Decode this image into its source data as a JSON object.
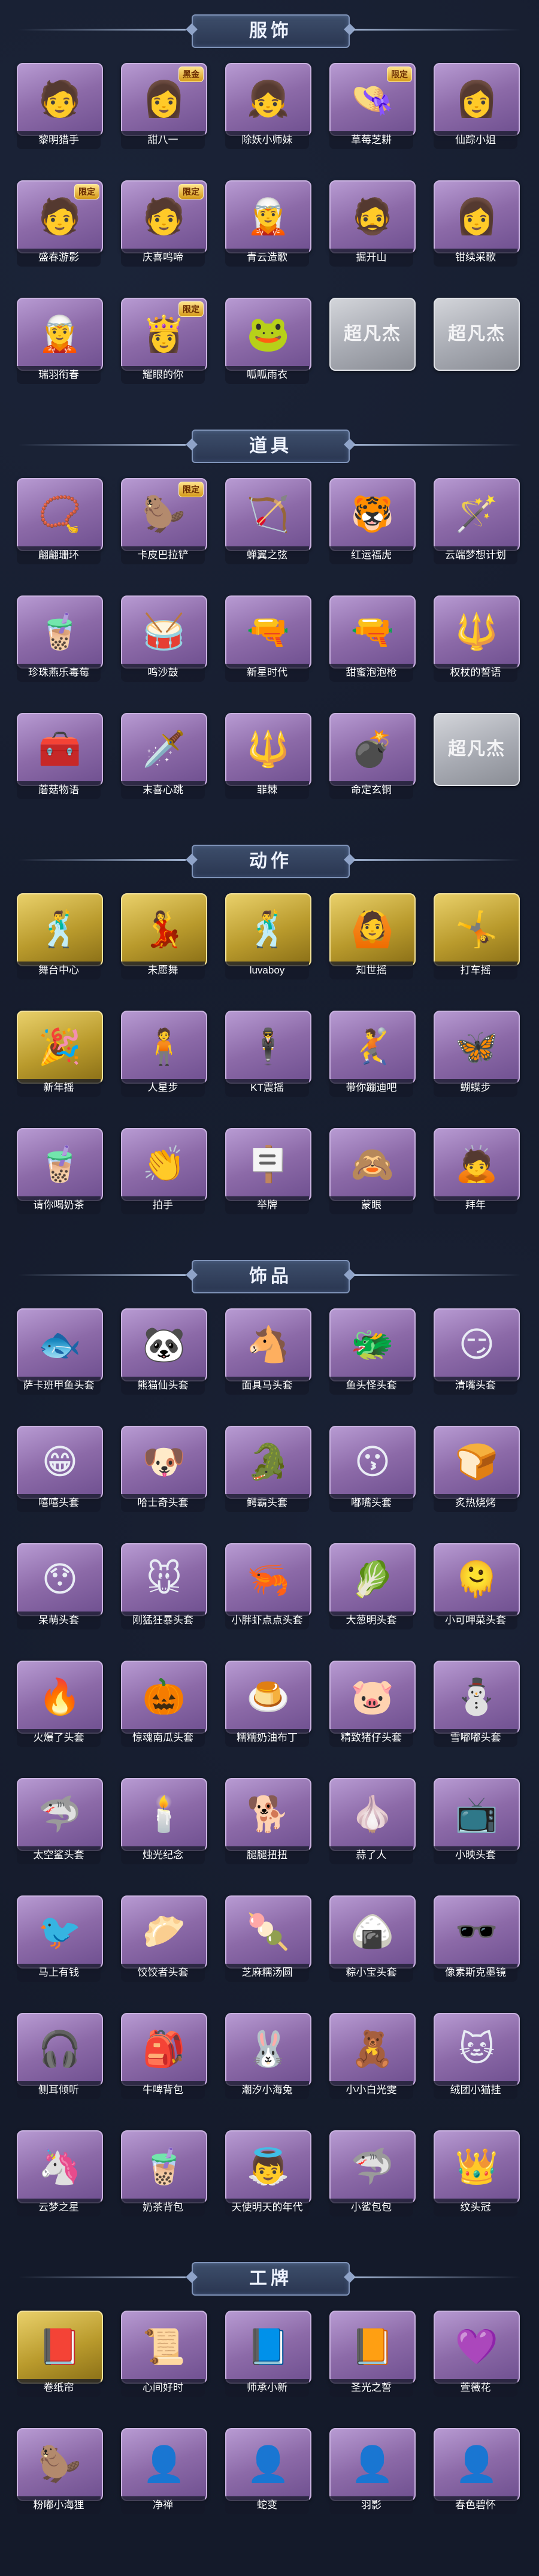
{
  "sections": [
    {
      "title": "服饰",
      "items": [
        {
          "label": "黎明猎手",
          "icon": "character-portrait-icon",
          "tone": "purple",
          "glyph": "🧑"
        },
        {
          "label": "甜八一",
          "icon": "character-portrait-icon",
          "tone": "purple",
          "glyph": "👩",
          "badge": "黑金"
        },
        {
          "label": "除妖小师妹",
          "icon": "character-portrait-icon",
          "tone": "purple",
          "glyph": "👧"
        },
        {
          "label": "草莓芝耕",
          "icon": "character-portrait-icon",
          "tone": "purple",
          "glyph": "👒",
          "badge": "限定"
        },
        {
          "label": "仙踪小姐",
          "icon": "character-portrait-icon",
          "tone": "purple",
          "glyph": "👩"
        },
        {
          "label": "盛春游影",
          "icon": "character-portrait-icon",
          "tone": "purple",
          "glyph": "🧑",
          "badge": "限定"
        },
        {
          "label": "庆喜鸣啼",
          "icon": "character-portrait-icon",
          "tone": "purple",
          "glyph": "🧑",
          "badge": "限定"
        },
        {
          "label": "青云造歌",
          "icon": "character-portrait-icon",
          "tone": "purple",
          "glyph": "🧝"
        },
        {
          "label": "掘开山",
          "icon": "character-portrait-icon",
          "tone": "purple",
          "glyph": "🧔"
        },
        {
          "label": "钳续采歌",
          "icon": "character-portrait-icon",
          "tone": "purple",
          "glyph": "👩"
        },
        {
          "label": "瑞羽衔春",
          "icon": "character-portrait-icon",
          "tone": "purple",
          "glyph": "🧝"
        },
        {
          "label": "耀眼的你",
          "icon": "character-portrait-icon",
          "tone": "purple",
          "glyph": "👸",
          "badge": "限定"
        },
        {
          "label": "呱呱雨衣",
          "icon": "character-portrait-icon",
          "tone": "purple",
          "glyph": "🐸"
        },
        {
          "label": "",
          "icon": "placeholder-logo-icon",
          "tone": "gray",
          "glyph": "超凡杰"
        },
        {
          "label": "",
          "icon": "placeholder-logo-icon",
          "tone": "gray",
          "glyph": "超凡杰"
        }
      ]
    },
    {
      "title": "道具",
      "items": [
        {
          "label": "翩翩珊环",
          "icon": "bracelet-icon",
          "tone": "purple",
          "glyph": "📿"
        },
        {
          "label": "卡皮巴拉铲",
          "icon": "capybara-icon",
          "tone": "purple",
          "glyph": "🦫",
          "badge": "限定"
        },
        {
          "label": "蝉翼之弦",
          "icon": "bow-icon",
          "tone": "purple",
          "glyph": "🏹"
        },
        {
          "label": "红运福虎",
          "icon": "tiger-icon",
          "tone": "purple",
          "glyph": "🐯"
        },
        {
          "label": "云端梦想计划",
          "icon": "magic-wand-icon",
          "tone": "purple",
          "glyph": "🪄"
        },
        {
          "label": "珍珠燕乐毒莓",
          "icon": "drink-icon",
          "tone": "purple",
          "glyph": "🧋"
        },
        {
          "label": "鸣沙鼓",
          "icon": "drum-icon",
          "tone": "purple",
          "glyph": "🥁"
        },
        {
          "label": "新星时代",
          "icon": "pistol-icon",
          "tone": "purple",
          "glyph": "🔫"
        },
        {
          "label": "甜蜜泡泡枪",
          "icon": "bubble-gun-icon",
          "tone": "purple",
          "glyph": "🔫"
        },
        {
          "label": "权杖的誓语",
          "icon": "scepter-icon",
          "tone": "purple",
          "glyph": "🔱"
        },
        {
          "label": "蘑菇物语",
          "icon": "medkit-icon",
          "tone": "purple",
          "glyph": "🧰"
        },
        {
          "label": "末喜心跳",
          "icon": "sword-icon",
          "tone": "purple",
          "glyph": "🗡️"
        },
        {
          "label": "罪棘",
          "icon": "spear-icon",
          "tone": "purple",
          "glyph": "🔱"
        },
        {
          "label": "命定玄铜",
          "icon": "grenade-icon",
          "tone": "purple",
          "glyph": "💣"
        },
        {
          "label": "",
          "icon": "placeholder-logo-icon",
          "tone": "gray",
          "glyph": "超凡杰"
        }
      ]
    },
    {
      "title": "动作",
      "items": [
        {
          "label": "舞台中心",
          "icon": "dance-pose-icon",
          "tone": "gold",
          "glyph": "🕺"
        },
        {
          "label": "未愿舞",
          "icon": "dance-pose-icon",
          "tone": "gold",
          "glyph": "💃"
        },
        {
          "label": "luvaboy",
          "icon": "dance-pose-icon",
          "tone": "gold",
          "glyph": "🕺"
        },
        {
          "label": "知世摇",
          "icon": "dance-pose-icon",
          "tone": "gold",
          "glyph": "🙆"
        },
        {
          "label": "打车摇",
          "icon": "dance-pose-icon",
          "tone": "gold",
          "glyph": "🤸"
        },
        {
          "label": "新年摇",
          "icon": "dance-pose-icon",
          "tone": "gold",
          "glyph": "🎉"
        },
        {
          "label": "人星步",
          "icon": "dance-pose-icon",
          "tone": "purple",
          "glyph": "🧍"
        },
        {
          "label": "KT震摇",
          "icon": "dance-pose-icon",
          "tone": "purple",
          "glyph": "🕴️"
        },
        {
          "label": "带你蹦迪吧",
          "icon": "dance-pose-icon",
          "tone": "purple",
          "glyph": "🤾"
        },
        {
          "label": "蝴蝶步",
          "icon": "dance-pose-icon",
          "tone": "purple",
          "glyph": "🦋"
        },
        {
          "label": "请你喝奶茶",
          "icon": "pose-icon",
          "tone": "purple",
          "glyph": "🧋"
        },
        {
          "label": "拍手",
          "icon": "pose-icon",
          "tone": "purple",
          "glyph": "👏"
        },
        {
          "label": "举牌",
          "icon": "pose-icon",
          "tone": "purple",
          "glyph": "🪧"
        },
        {
          "label": "蒙眼",
          "icon": "pose-icon",
          "tone": "purple",
          "glyph": "🙈"
        },
        {
          "label": "拜年",
          "icon": "pose-icon",
          "tone": "purple",
          "glyph": "🙇"
        }
      ]
    },
    {
      "title": "饰品",
      "items": [
        {
          "label": "萨卡班甲鱼头套",
          "icon": "fish-head-icon",
          "tone": "purple",
          "glyph": "🐟"
        },
        {
          "label": "熊猫仙头套",
          "icon": "panda-head-icon",
          "tone": "purple",
          "glyph": "🐼"
        },
        {
          "label": "面具马头套",
          "icon": "horse-head-icon",
          "tone": "purple",
          "glyph": "🐴"
        },
        {
          "label": "鱼头怪头套",
          "icon": "fish-monster-icon",
          "tone": "purple",
          "glyph": "🐲"
        },
        {
          "label": "清嘴头套",
          "icon": "smiley-head-icon",
          "tone": "purple",
          "glyph": "😏"
        },
        {
          "label": "嘻嘻头套",
          "icon": "grin-head-icon",
          "tone": "purple",
          "glyph": "😁"
        },
        {
          "label": "哈士奇头套",
          "icon": "husky-head-icon",
          "tone": "purple",
          "glyph": "🐶"
        },
        {
          "label": "鳄霸头套",
          "icon": "crocodile-head-icon",
          "tone": "purple",
          "glyph": "🐊"
        },
        {
          "label": "嘟嘴头套",
          "icon": "pout-head-icon",
          "tone": "purple",
          "glyph": "😗"
        },
        {
          "label": "炙热烧烤",
          "icon": "toast-head-icon",
          "tone": "purple",
          "glyph": "🍞"
        },
        {
          "label": "呆萌头套",
          "icon": "cute-head-icon",
          "tone": "purple",
          "glyph": "😯"
        },
        {
          "label": "刚猛狂暴头套",
          "icon": "pikachu-head-icon",
          "tone": "purple",
          "glyph": "🐭"
        },
        {
          "label": "小胖虾点点头套",
          "icon": "shrimp-head-icon",
          "tone": "purple",
          "glyph": "🦐"
        },
        {
          "label": "大葱明头套",
          "icon": "scallion-head-icon",
          "tone": "purple",
          "glyph": "🥬"
        },
        {
          "label": "小可呷菜头套",
          "icon": "blob-head-icon",
          "tone": "purple",
          "glyph": "🫠"
        },
        {
          "label": "火爆了头套",
          "icon": "fire-head-icon",
          "tone": "purple",
          "glyph": "🔥"
        },
        {
          "label": "惊魂南瓜头套",
          "icon": "pumpkin-head-icon",
          "tone": "purple",
          "glyph": "🎃"
        },
        {
          "label": "糯糯奶油布丁",
          "icon": "pudding-head-icon",
          "tone": "purple",
          "glyph": "🍮"
        },
        {
          "label": "精致猪仔头套",
          "icon": "pig-head-icon",
          "tone": "purple",
          "glyph": "🐷"
        },
        {
          "label": "雪嘟嘟头套",
          "icon": "snowman-head-icon",
          "tone": "purple",
          "glyph": "⛄"
        },
        {
          "label": "太空鲨头套",
          "icon": "shark-head-icon",
          "tone": "purple",
          "glyph": "🦈"
        },
        {
          "label": "烛光纪念",
          "icon": "candle-head-icon",
          "tone": "purple",
          "glyph": "🕯️"
        },
        {
          "label": "腿腿扭扭",
          "icon": "dog-head-icon",
          "tone": "purple",
          "glyph": "🐕"
        },
        {
          "label": "蒜了人",
          "icon": "garlic-head-icon",
          "tone": "purple",
          "glyph": "🧄"
        },
        {
          "label": "小映头套",
          "icon": "tv-head-icon",
          "tone": "purple",
          "glyph": "📺"
        },
        {
          "label": "马上有钱",
          "icon": "bird-head-icon",
          "tone": "purple",
          "glyph": "🐦"
        },
        {
          "label": "饺饺者头套",
          "icon": "dumpling-head-icon",
          "tone": "purple",
          "glyph": "🥟"
        },
        {
          "label": "芝麻糯汤圆",
          "icon": "riceball-head-icon",
          "tone": "purple",
          "glyph": "🍡"
        },
        {
          "label": "粽小宝头套",
          "icon": "zongzi-head-icon",
          "tone": "purple",
          "glyph": "🍙"
        },
        {
          "label": "像素斯克墨镜",
          "icon": "pixel-glasses-icon",
          "tone": "purple",
          "glyph": "🕶️"
        },
        {
          "label": "侧耳倾听",
          "icon": "headphones-icon",
          "tone": "purple",
          "glyph": "🎧"
        },
        {
          "label": "牛啤背包",
          "icon": "backpack-icon",
          "tone": "purple",
          "glyph": "🎒"
        },
        {
          "label": "潮汐小海兔",
          "icon": "sea-bunny-icon",
          "tone": "purple",
          "glyph": "🐰"
        },
        {
          "label": "小小白光雯",
          "icon": "doll-icon",
          "tone": "purple",
          "glyph": "🧸"
        },
        {
          "label": "绒团小猫挂",
          "icon": "cat-charm-icon",
          "tone": "purple",
          "glyph": "🐱"
        },
        {
          "label": "云梦之星",
          "icon": "star-icon",
          "tone": "purple",
          "glyph": "🦄"
        },
        {
          "label": "奶茶背包",
          "icon": "milk-tea-bag-icon",
          "tone": "purple",
          "glyph": "🧋"
        },
        {
          "label": "天使明天的年代",
          "icon": "angel-icon",
          "tone": "purple",
          "glyph": "👼"
        },
        {
          "label": "小鲨包包",
          "icon": "shark-bag-icon",
          "tone": "purple",
          "glyph": "🦈"
        },
        {
          "label": "纹头冠",
          "icon": "crown-icon",
          "tone": "purple",
          "glyph": "👑"
        }
      ]
    },
    {
      "title": "工牌",
      "items": [
        {
          "label": "卷纸帘",
          "icon": "badge-card-icon",
          "tone": "gold",
          "glyph": "📕"
        },
        {
          "label": "心间好时",
          "icon": "badge-card-icon",
          "tone": "purple",
          "glyph": "📜"
        },
        {
          "label": "师承小新",
          "icon": "badge-card-icon",
          "tone": "purple",
          "glyph": "📘"
        },
        {
          "label": "圣光之誓",
          "icon": "badge-card-icon",
          "tone": "purple",
          "glyph": "📙"
        },
        {
          "label": "萱薇花",
          "icon": "badge-card-icon",
          "tone": "purple",
          "glyph": "💜"
        },
        {
          "label": "粉嘟小海狸",
          "icon": "badge-card-icon",
          "tone": "purple",
          "glyph": "🦫"
        },
        {
          "label": "净禅",
          "icon": "silhouette-card-icon",
          "tone": "purple",
          "glyph": "👤"
        },
        {
          "label": "蛇变",
          "icon": "silhouette-card-icon",
          "tone": "purple",
          "glyph": "👤"
        },
        {
          "label": "羽影",
          "icon": "silhouette-card-icon",
          "tone": "purple",
          "glyph": "👤"
        },
        {
          "label": "春色碧怀",
          "icon": "silhouette-card-icon",
          "tone": "purple",
          "glyph": "👤"
        }
      ]
    }
  ]
}
